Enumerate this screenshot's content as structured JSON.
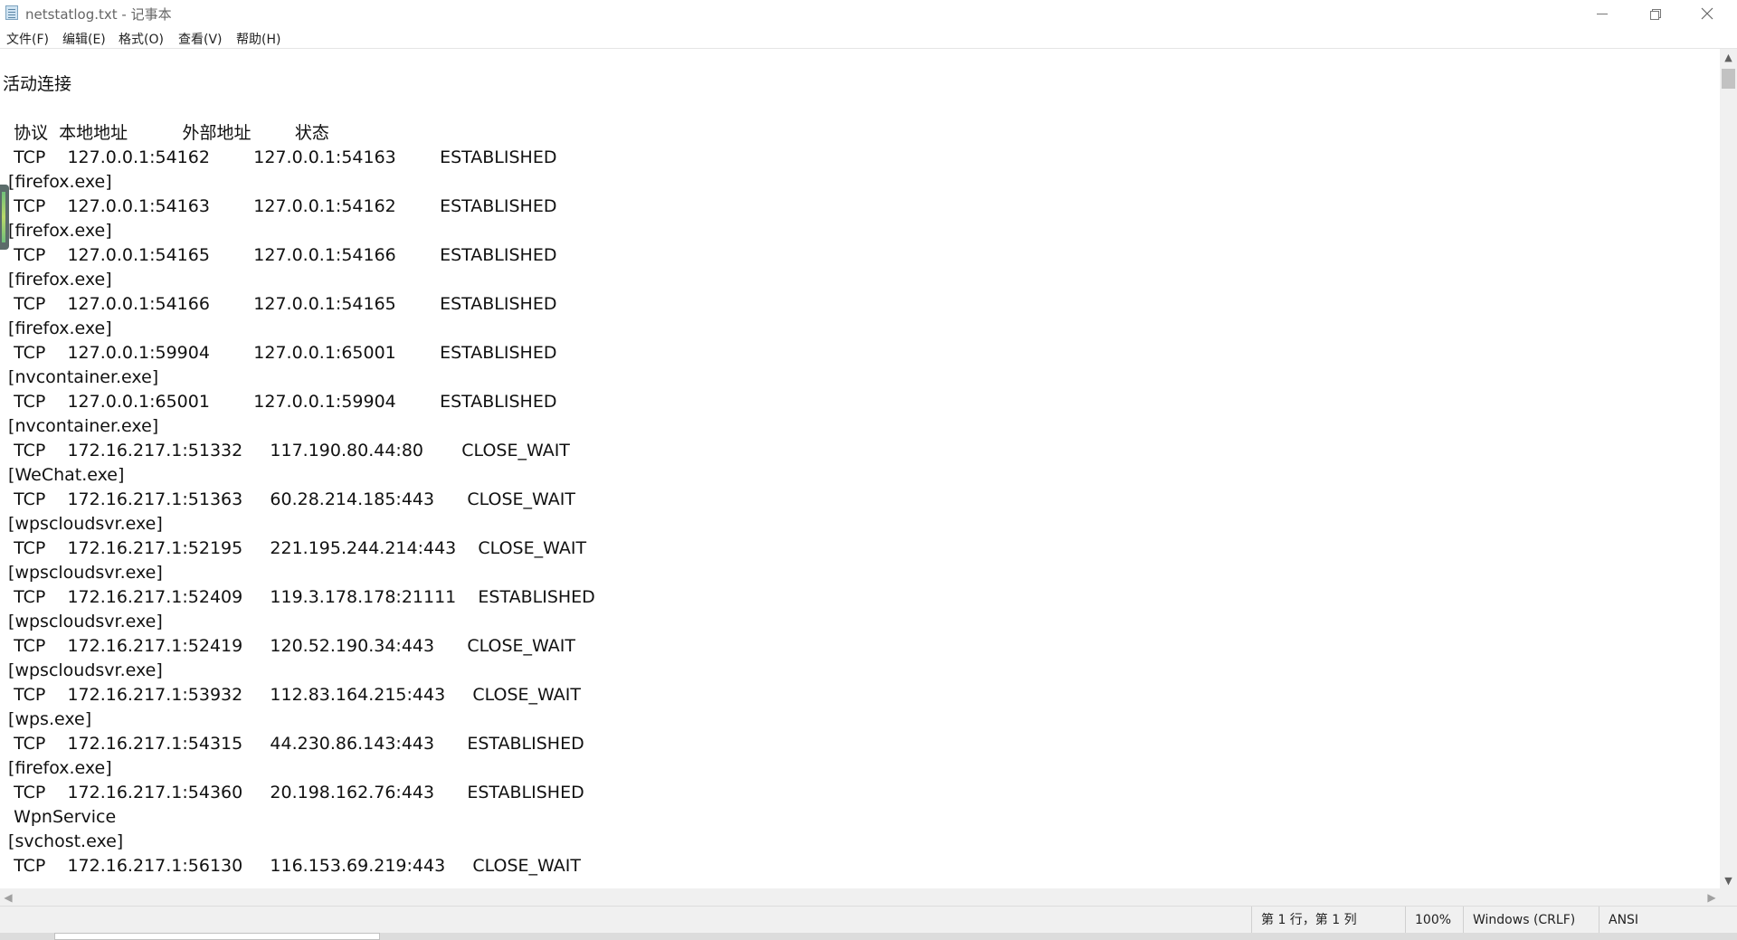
{
  "window": {
    "title": "netstatlog.txt - 记事本",
    "minimize_icon": "minimize-icon",
    "maximize_icon": "restore-icon",
    "close_icon": "close-icon"
  },
  "menu": [
    {
      "label": "文件(F)"
    },
    {
      "label": "编辑(E)"
    },
    {
      "label": "格式(O)"
    },
    {
      "label": "查看(V)"
    },
    {
      "label": "帮助(H)"
    }
  ],
  "document": {
    "lines": [
      "活动连接",
      "",
      "  协议  本地地址          外部地址        状态",
      "  TCP    127.0.0.1:54162        127.0.0.1:54163        ESTABLISHED",
      " [firefox.exe]",
      "  TCP    127.0.0.1:54163        127.0.0.1:54162        ESTABLISHED",
      " [firefox.exe]",
      "  TCP    127.0.0.1:54165        127.0.0.1:54166        ESTABLISHED",
      " [firefox.exe]",
      "  TCP    127.0.0.1:54166        127.0.0.1:54165        ESTABLISHED",
      " [firefox.exe]",
      "  TCP    127.0.0.1:59904        127.0.0.1:65001        ESTABLISHED",
      " [nvcontainer.exe]",
      "  TCP    127.0.0.1:65001        127.0.0.1:59904        ESTABLISHED",
      " [nvcontainer.exe]",
      "  TCP    172.16.217.1:51332     117.190.80.44:80       CLOSE_WAIT",
      " [WeChat.exe]",
      "  TCP    172.16.217.1:51363     60.28.214.185:443      CLOSE_WAIT",
      " [wpscloudsvr.exe]",
      "  TCP    172.16.217.1:52195     221.195.244.214:443    CLOSE_WAIT",
      " [wpscloudsvr.exe]",
      "  TCP    172.16.217.1:52409     119.3.178.178:21111    ESTABLISHED",
      " [wpscloudsvr.exe]",
      "  TCP    172.16.217.1:52419     120.52.190.34:443      CLOSE_WAIT",
      " [wpscloudsvr.exe]",
      "  TCP    172.16.217.1:53932     112.83.164.215:443     CLOSE_WAIT",
      " [wps.exe]",
      "  TCP    172.16.217.1:54315     44.230.86.143:443      ESTABLISHED",
      " [firefox.exe]",
      "  TCP    172.16.217.1:54360     20.198.162.76:443      ESTABLISHED",
      "  WpnService",
      " [svchost.exe]",
      "  TCP    172.16.217.1:56130     116.153.69.219:443     CLOSE_WAIT"
    ]
  },
  "status": {
    "position": "第 1 行，第 1 列",
    "zoom": "100%",
    "line_ending": "Windows (CRLF)",
    "encoding": "ANSI"
  }
}
